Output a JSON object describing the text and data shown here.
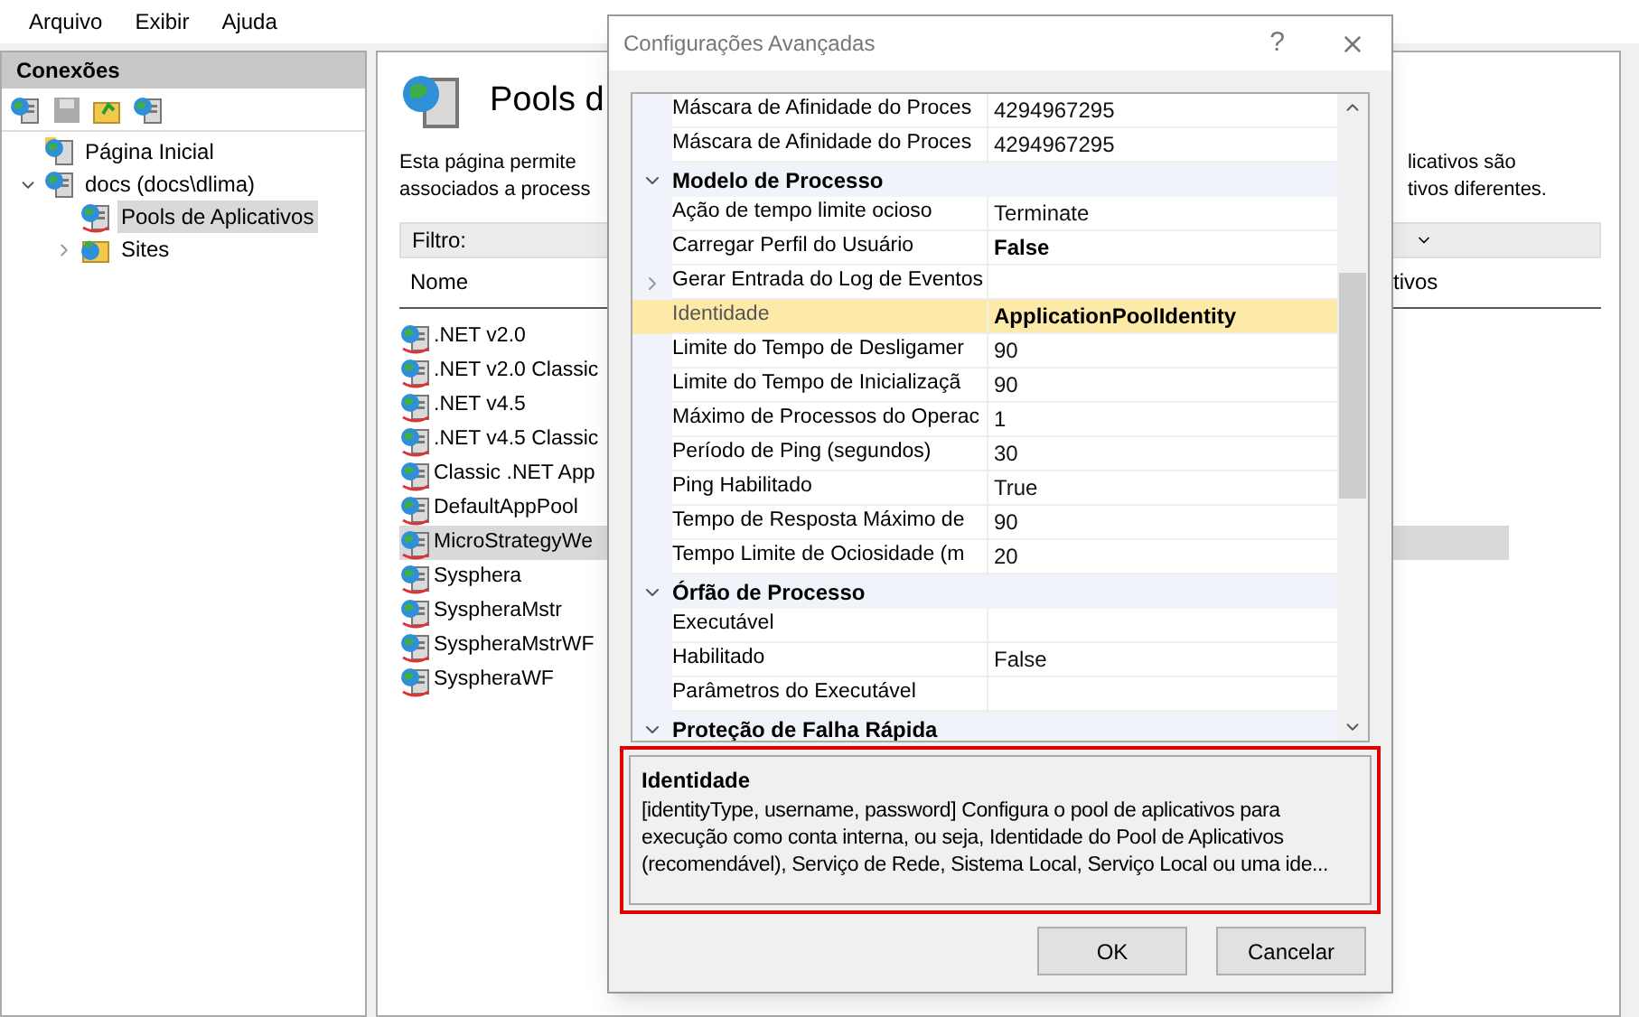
{
  "menu": [
    {
      "label": "Arquivo"
    },
    {
      "label": "Exibir"
    },
    {
      "label": "Ajuda"
    }
  ],
  "connections": {
    "title": "Conexões",
    "tree": [
      {
        "label": "Página Inicial",
        "kind": "home",
        "selected": false
      },
      {
        "label": "docs (docs\\dlima)",
        "kind": "server",
        "selected": false,
        "expanded": true,
        "children": [
          {
            "label": "Pools de Aplicativos",
            "kind": "pools",
            "selected": true
          },
          {
            "label": "Sites",
            "kind": "sites",
            "selected": false,
            "expanded": false
          }
        ]
      }
    ]
  },
  "page": {
    "title": "Pools d",
    "description_left": [
      "Esta página permite",
      "associados a process"
    ],
    "description_right": [
      "licativos são",
      "tivos diferentes."
    ],
    "filter_label": "Filtro:",
    "columns": [
      "Nome",
      "tivos"
    ],
    "rows": [
      {
        "name": ".NET v2.0",
        "selected": false
      },
      {
        "name": ".NET v2.0 Classic",
        "selected": false
      },
      {
        "name": ".NET v4.5",
        "selected": false
      },
      {
        "name": ".NET v4.5 Classic",
        "selected": false
      },
      {
        "name": "Classic .NET App",
        "selected": false
      },
      {
        "name": "DefaultAppPool",
        "selected": false
      },
      {
        "name": "MicroStrategyWe",
        "selected": true
      },
      {
        "name": "Sysphera",
        "selected": false
      },
      {
        "name": "SyspheraMstr",
        "selected": false
      },
      {
        "name": "SyspheraMstrWF",
        "selected": false
      },
      {
        "name": "SyspheraWF",
        "selected": false
      }
    ]
  },
  "dialog": {
    "title": "Configurações Avançadas",
    "help": "?",
    "properties": [
      {
        "kind": "property",
        "name": "Máscara de Afinidade do Proces",
        "value": "4294967295",
        "modified": false,
        "selected": false
      },
      {
        "kind": "property",
        "name": "Máscara de Afinidade do Proces",
        "value": "4294967295",
        "modified": false,
        "selected": false
      },
      {
        "kind": "category",
        "name": "Modelo de Processo",
        "expanded": true
      },
      {
        "kind": "property",
        "name": "Ação de tempo limite ocioso",
        "value": "Terminate",
        "modified": false,
        "selected": false
      },
      {
        "kind": "property",
        "name": "Carregar Perfil do Usuário",
        "value": "False",
        "modified": true,
        "selected": false
      },
      {
        "kind": "group",
        "name": "Gerar Entrada do Log de Eventos",
        "expanded": false,
        "selected": false
      },
      {
        "kind": "property",
        "name": "Identidade",
        "value": "ApplicationPoolIdentity",
        "modified": true,
        "selected": true
      },
      {
        "kind": "property",
        "name": "Limite do Tempo de Desligamer",
        "value": "90",
        "modified": false,
        "selected": false
      },
      {
        "kind": "property",
        "name": "Limite do Tempo de Inicializaçã",
        "value": "90",
        "modified": false,
        "selected": false
      },
      {
        "kind": "property",
        "name": "Máximo de Processos do Operac",
        "value": "1",
        "modified": false,
        "selected": false
      },
      {
        "kind": "property",
        "name": "Período de Ping (segundos)",
        "value": "30",
        "modified": false,
        "selected": false
      },
      {
        "kind": "property",
        "name": "Ping Habilitado",
        "value": "True",
        "modified": false,
        "selected": false
      },
      {
        "kind": "property",
        "name": "Tempo de Resposta Máximo de",
        "value": "90",
        "modified": false,
        "selected": false
      },
      {
        "kind": "property",
        "name": "Tempo Limite de Ociosidade (m",
        "value": "20",
        "modified": false,
        "selected": false
      },
      {
        "kind": "category",
        "name": "Órfão de Processo",
        "expanded": true
      },
      {
        "kind": "property",
        "name": "Executável",
        "selected": false
      },
      {
        "kind": "property",
        "name": "Habilitado",
        "value": "False",
        "modified": false,
        "selected": false
      },
      {
        "kind": "property",
        "name": "Parâmetros do Executável",
        "selected": false
      },
      {
        "kind": "category",
        "name": "Proteção de Falha Rápida",
        "expanded": true
      }
    ],
    "description": {
      "title": "Identidade",
      "text": "[identityType, username, password] Configura o pool de aplicativos para execução como conta interna, ou seja, Identidade do Pool de Aplicativos (recomendável), Serviço de Rede, Sistema Local, Serviço Local ou uma ide..."
    },
    "buttons": [
      {
        "label": "OK"
      },
      {
        "label": "Cancelar"
      }
    ]
  }
}
